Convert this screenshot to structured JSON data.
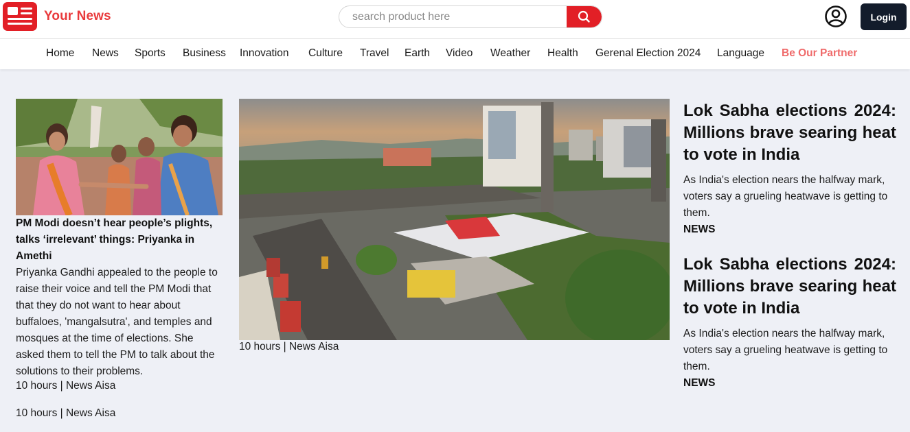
{
  "header": {
    "brand": "Your News",
    "search_placeholder": "search product here",
    "login_label": "Login",
    "accent_color": "#e21f26",
    "icons": [
      "newspaper-logo-icon",
      "search-icon",
      "user-icon"
    ]
  },
  "nav": {
    "items": [
      "Home",
      "News",
      "Sports",
      "Business",
      "Innovation",
      "Culture",
      "Travel",
      "Earth",
      "Video",
      "Weather",
      "Health",
      "Gerenal Election 2024",
      "Language"
    ],
    "partner": "Be Our Partner"
  },
  "left_story": {
    "title": "PM Modi doesn’t hear people’s plights, talks ‘irrelevant’ things: Priyanka in Amethi",
    "body": "Priyanka Gandhi appealed to the people to raise their voice and tell the PM Modi that that they do not want to hear about buffaloes, 'mangalsutra', and temples and mosques at the time of elections. She asked them to tell the PM to talk about the solutions to their problems.",
    "meta": "10 hours | News Aisa",
    "meta2": "10 hours | News Aisa"
  },
  "main_story": {
    "meta": "10 hours | News Aisa"
  },
  "right_stories": [
    {
      "title": "Lok Sabha elections 2024: Millions brave searing heat to vote in India",
      "summary": "As India's election nears the halfway mark, voters say a grueling heatwave is getting to them.",
      "tag": "NEWS"
    },
    {
      "title": "Lok Sabha elections 2024: Millions brave searing heat to vote in India",
      "summary": "As India's election nears the halfway mark, voters say a grueling heatwave is getting to them.",
      "tag": "NEWS"
    }
  ]
}
